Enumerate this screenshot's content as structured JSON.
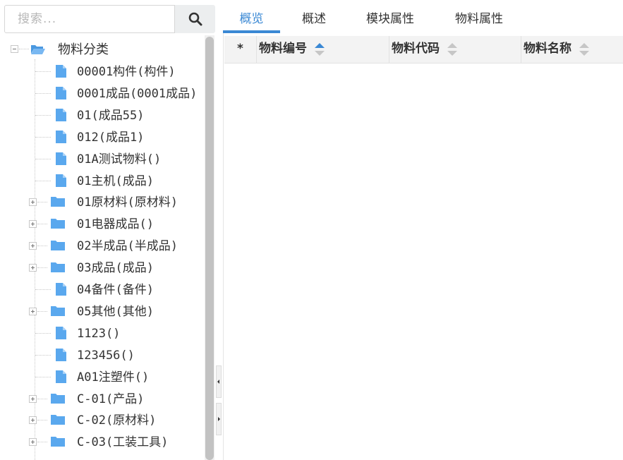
{
  "search": {
    "placeholder": "搜索..."
  },
  "tree": {
    "root": {
      "label": "物料分类"
    },
    "items": [
      {
        "label": "00001构件(构件)",
        "has_children": false
      },
      {
        "label": "0001成品(0001成品)",
        "has_children": false
      },
      {
        "label": "01(成品55)",
        "has_children": false
      },
      {
        "label": "012(成品1)",
        "has_children": false
      },
      {
        "label": "01A测试物料()",
        "has_children": false
      },
      {
        "label": "01主机(成品)",
        "has_children": false
      },
      {
        "label": "01原材料(原材料)",
        "has_children": true
      },
      {
        "label": "01电器成品()",
        "has_children": true
      },
      {
        "label": "02半成品(半成品)",
        "has_children": true
      },
      {
        "label": "03成品(成品)",
        "has_children": true
      },
      {
        "label": "04备件(备件)",
        "has_children": false
      },
      {
        "label": "05其他(其他)",
        "has_children": true
      },
      {
        "label": "1123()",
        "has_children": false
      },
      {
        "label": "123456()",
        "has_children": false
      },
      {
        "label": "A01注塑件()",
        "has_children": false
      },
      {
        "label": "C-01(产品)",
        "has_children": true
      },
      {
        "label": "C-02(原材料)",
        "has_children": true
      },
      {
        "label": "C-03(工装工具)",
        "has_children": true
      }
    ]
  },
  "tabs": [
    {
      "label": "概览",
      "active": true
    },
    {
      "label": "概述",
      "active": false
    },
    {
      "label": "模块属性",
      "active": false
    },
    {
      "label": "物料属性",
      "active": false
    }
  ],
  "grid": {
    "star": "*",
    "columns": [
      {
        "label": "物料编号",
        "sort": "asc"
      },
      {
        "label": "物料代码",
        "sort": "none"
      },
      {
        "label": "物料名称",
        "sort": "none"
      }
    ]
  },
  "colors": {
    "accent": "#3a88d4",
    "file_icon": "#5aa8ee",
    "folder_icon": "#5aa8ee"
  }
}
